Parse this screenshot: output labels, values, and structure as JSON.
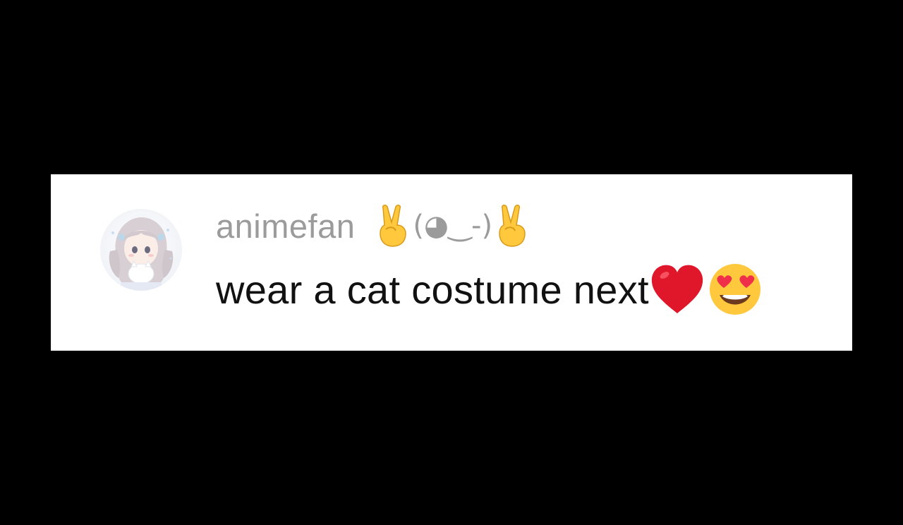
{
  "comment": {
    "username": "animefan",
    "username_kaomoji": "(◕‿-)",
    "text": "wear a cat costume next",
    "emojis": [
      "victory-hand",
      "victory-hand",
      "red-heart",
      "heart-eyes"
    ]
  },
  "colors": {
    "background": "#000000",
    "card": "#ffffff",
    "username": "#9b9b9b",
    "text": "#111111",
    "heart": "#e0162b",
    "emoji_face": "#ffc83d"
  }
}
